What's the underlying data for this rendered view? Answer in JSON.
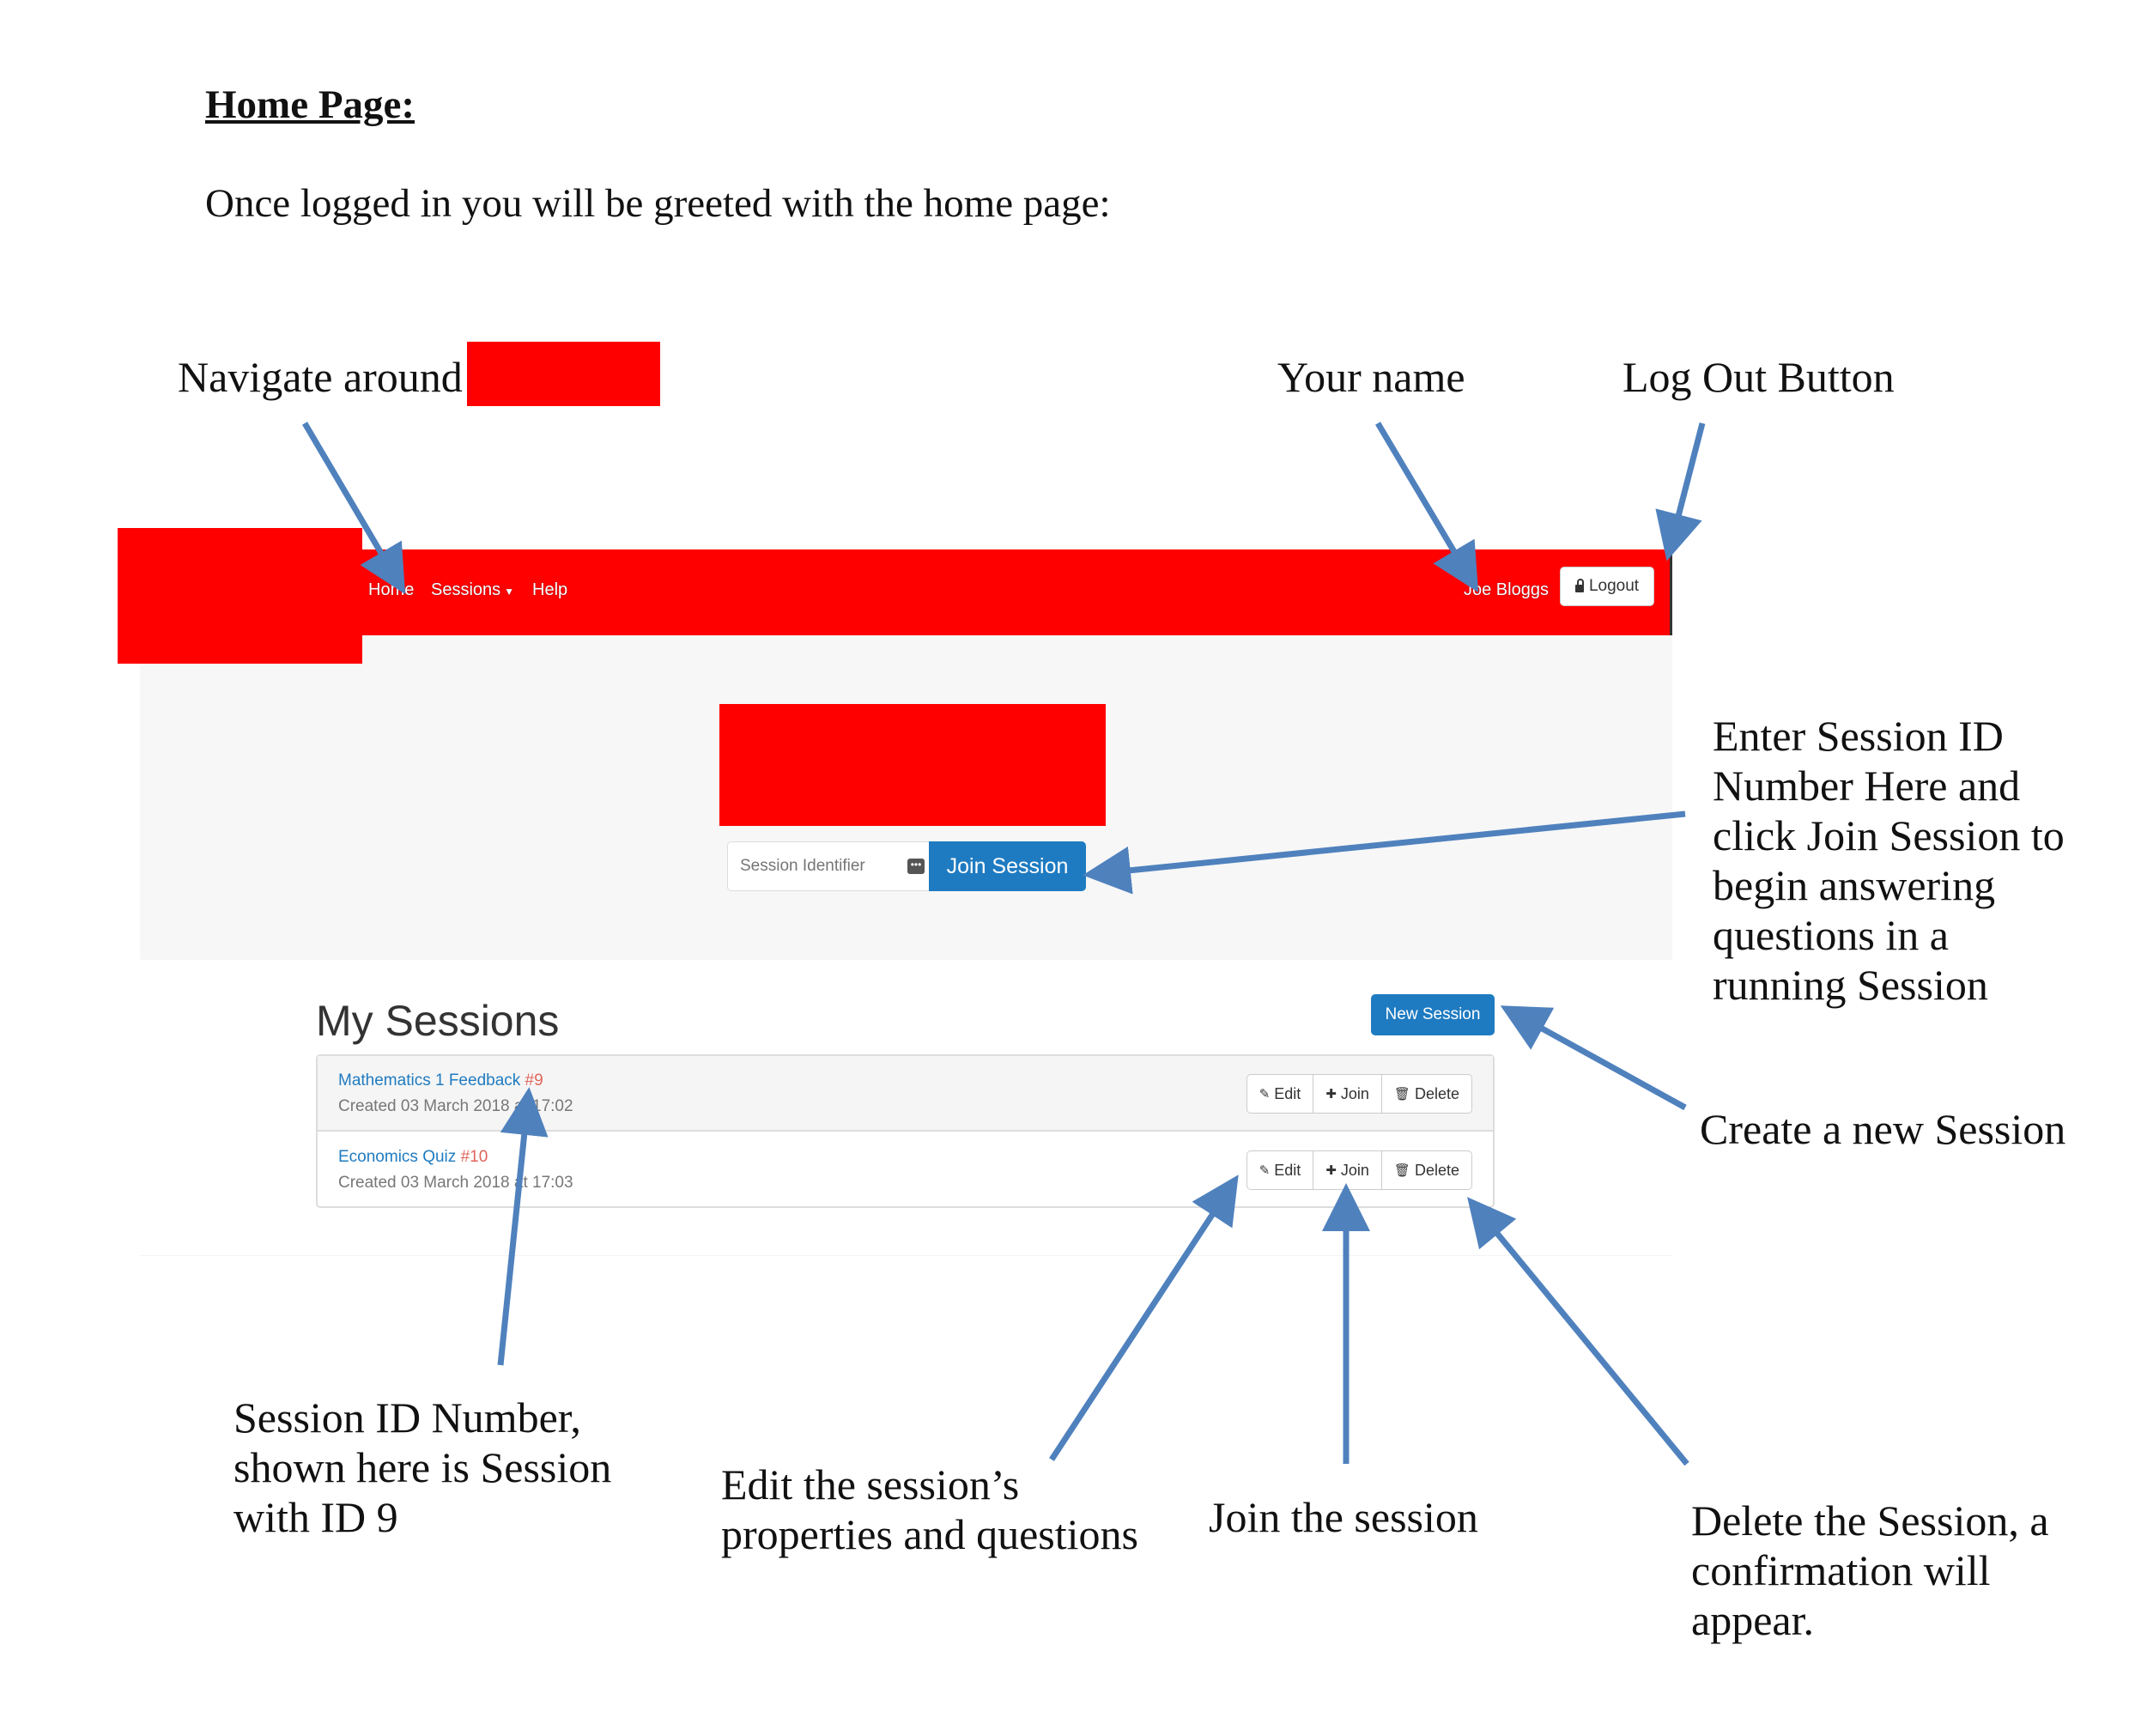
{
  "doc": {
    "title": "Home Page:",
    "intro": "Once logged in you will be greeted with the home page:"
  },
  "callouts": {
    "navigate": "Navigate around",
    "your_name": "Your name",
    "log_out": "Log Out Button",
    "enter_session": [
      "Enter Session ID",
      "Number Here and",
      "click Join Session to",
      "begin answering",
      "questions in a",
      "running Session"
    ],
    "create_session": "Create a new Session",
    "session_id": [
      "Session ID Number,",
      "shown here is Session",
      "with ID 9"
    ],
    "edit": [
      "Edit the session’s",
      "properties and questions"
    ],
    "join": "Join the session",
    "delete": [
      "Delete the Session, a",
      "confirmation will",
      "appear."
    ]
  },
  "navbar": {
    "links": [
      "Home",
      "Sessions",
      "Help"
    ],
    "user_name": "Joe Bloggs",
    "logout_label": "Logout"
  },
  "join_form": {
    "placeholder": "Session Identifier",
    "button_label": "Join Session"
  },
  "my_sessions": {
    "title": "My Sessions",
    "new_session_label": "New Session",
    "sessions": [
      {
        "name": "Mathematics 1 Feedback",
        "id": "#9",
        "created": "Created 03 March 2018 at 17:02"
      },
      {
        "name": "Economics Quiz",
        "id": "#10",
        "created": "Created 03 March 2018 at 17:03"
      }
    ],
    "actions": {
      "edit": "Edit",
      "join": "Join",
      "delete": "Delete"
    }
  },
  "colors": {
    "navbar": "#ff0000",
    "primary": "#1f7bc1",
    "arrow": "#4f81bd",
    "session_id": "#e0645a"
  }
}
